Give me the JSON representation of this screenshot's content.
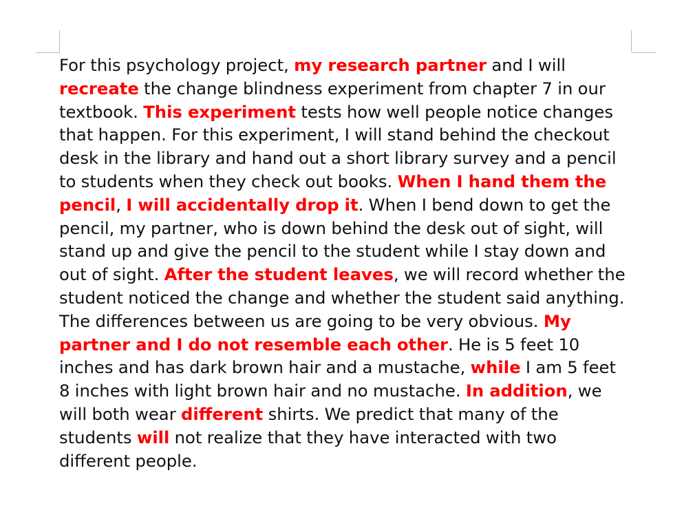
{
  "document": {
    "highlight_color": "#ff0000",
    "text_color": "#111111",
    "segments": [
      {
        "text": "For this psychology project, ",
        "highlight": false
      },
      {
        "text": "my research partner",
        "highlight": true
      },
      {
        "text": " and I will ",
        "highlight": false
      },
      {
        "text": "recreate",
        "highlight": true
      },
      {
        "text": " the change blindness experiment from chapter 7 in our textbook. ",
        "highlight": false
      },
      {
        "text": "This experiment",
        "highlight": true
      },
      {
        "text": " tests how well people notice changes that happen. For this experiment, I will stand behind the checkout desk in the library and hand out a short library survey and a pencil to students when they check out books. ",
        "highlight": false
      },
      {
        "text": "When I hand them the pencil",
        "highlight": true
      },
      {
        "text": ", ",
        "highlight": false
      },
      {
        "text": "I will accidentally drop it",
        "highlight": true
      },
      {
        "text": ". When I bend down to get the pencil, my partner, who is down behind the desk out of sight, will stand up and give the pencil to the student while I stay down and out of sight. ",
        "highlight": false
      },
      {
        "text": "After the student leaves",
        "highlight": true
      },
      {
        "text": ", we will record whether the student noticed the change and whether the student said anything. The differences between us are going to be very obvious. ",
        "highlight": false
      },
      {
        "text": "My partner and I do not resemble each other",
        "highlight": true
      },
      {
        "text": ". He is 5 feet 10 inches and has dark brown hair and a mustache, ",
        "highlight": false
      },
      {
        "text": "while",
        "highlight": true
      },
      {
        "text": " I am 5 feet 8 inches with light brown hair and no mustache. ",
        "highlight": false
      },
      {
        "text": "In addition",
        "highlight": true
      },
      {
        "text": ", we will both wear ",
        "highlight": false
      },
      {
        "text": "different",
        "highlight": true
      },
      {
        "text": " shirts. We predict that many of the students ",
        "highlight": false
      },
      {
        "text": "will",
        "highlight": true
      },
      {
        "text": " not realize that they have interacted with two different people.",
        "highlight": false
      }
    ]
  }
}
